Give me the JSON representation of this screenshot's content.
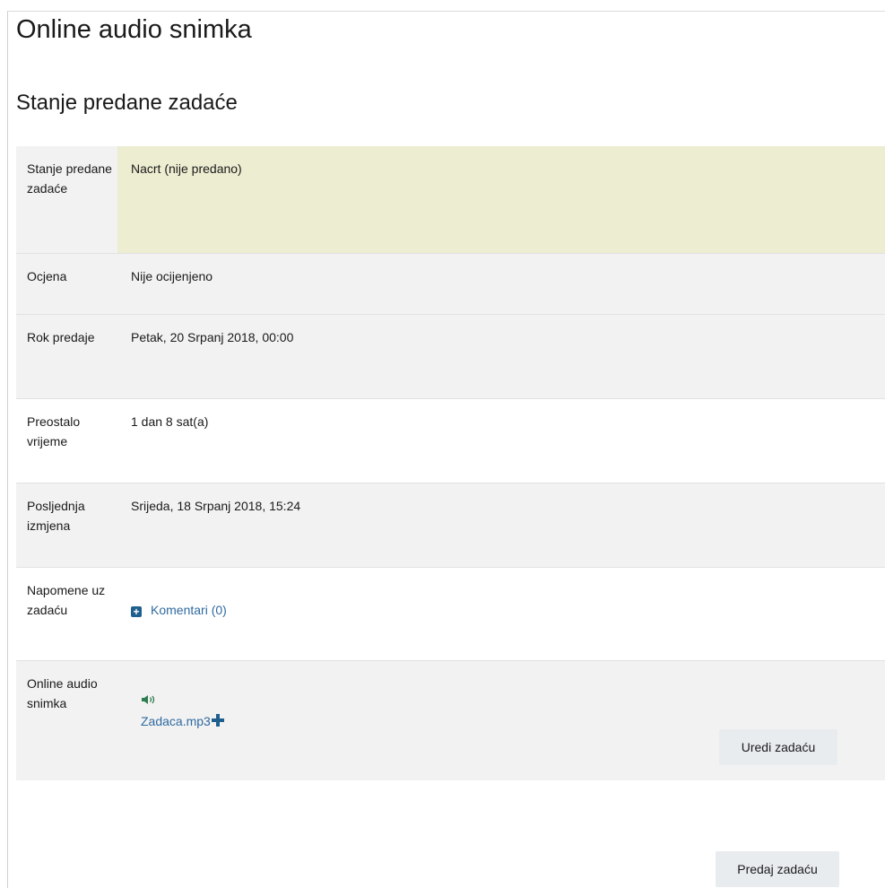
{
  "page": {
    "title": "Online audio snimka",
    "section_title": "Stanje predane zadaće"
  },
  "status_table": {
    "rows": [
      {
        "label": "Stanje predane zadaće",
        "value": "Nacrt (nije predano)"
      },
      {
        "label": "Ocjena",
        "value": "Nije ocijenjeno"
      },
      {
        "label": "Rok predaje",
        "value": "Petak, 20 Srpanj 2018, 00:00"
      },
      {
        "label": "Preostalo vrijeme",
        "value": "1 dan 8 sat(a)"
      },
      {
        "label": "Posljednja izmjena",
        "value": "Srijeda, 18 Srpanj 2018, 15:24"
      },
      {
        "label": "Napomene uz zadaću",
        "value": "Komentari (0)"
      },
      {
        "label": "Online audio snimka",
        "value": "Zadaca.mp3"
      }
    ]
  },
  "buttons": {
    "edit_label": "Uredi zadaću",
    "submit_label": "Predaj zadaću"
  },
  "icons": {
    "comments": "plus-square-icon",
    "audio": "speaker-icon",
    "file_add": "plus-icon"
  },
  "colors": {
    "status_highlight": "#ecedd1",
    "row_grey": "#f2f2f2",
    "link": "#2f6aa0",
    "button_bg": "#e9ecef",
    "audio_icon": "#2e7d4f"
  }
}
